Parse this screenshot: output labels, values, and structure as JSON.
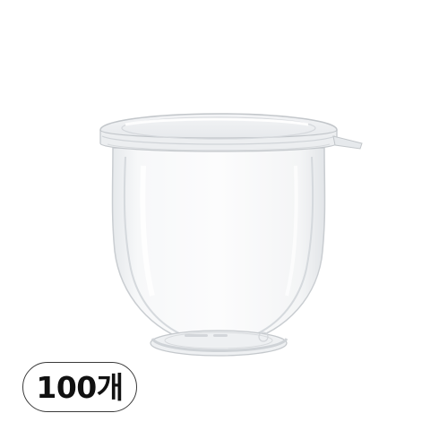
{
  "product": {
    "image_subject": "clear-plastic-cup-with-lid-icon"
  },
  "badge": {
    "quantity_label": "100개"
  }
}
